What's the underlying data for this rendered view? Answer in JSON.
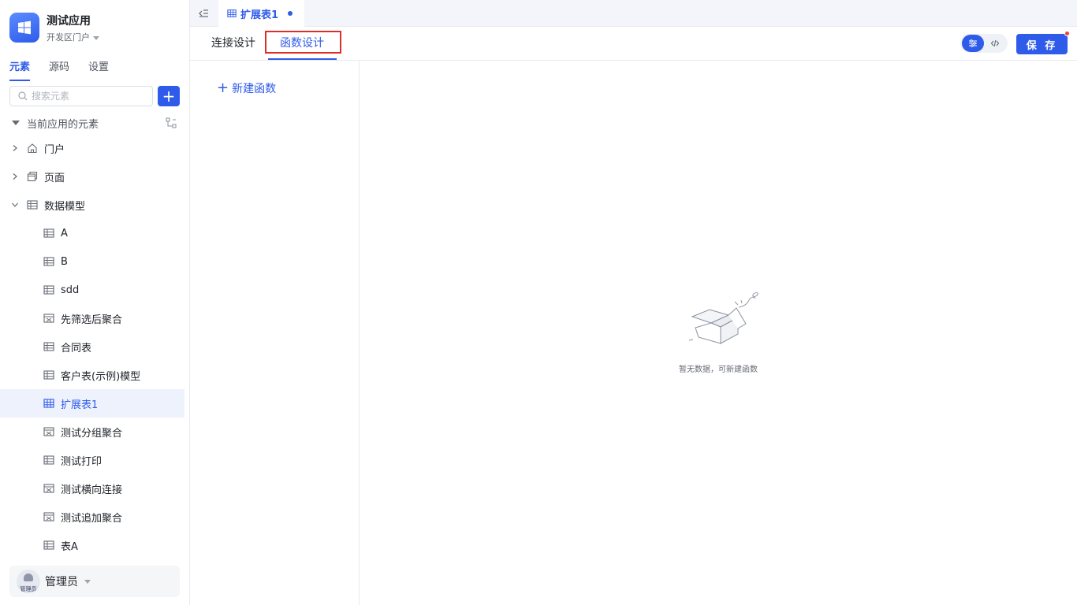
{
  "sidebar": {
    "app_name": "测试应用",
    "portal": "开发区门户",
    "tabs": [
      {
        "label": "元素",
        "active": true
      },
      {
        "label": "源码",
        "active": false
      },
      {
        "label": "设置",
        "active": false
      }
    ],
    "search": {
      "placeholder": "搜索元素",
      "value": ""
    },
    "add_label": "+",
    "section_label": "当前应用的元素",
    "tree": {
      "portal_label": "门户",
      "page_label": "页面",
      "model_label": "数据模型",
      "models": [
        "A",
        "B",
        "sdd",
        "先筛选后聚合",
        "合同表",
        "客户表(示例)模型",
        "扩展表1",
        "测试分组聚合",
        "测试打印",
        "测试横向连接",
        "测试追加聚合",
        "表A"
      ],
      "selected": "扩展表1"
    },
    "user": {
      "name": "管理员",
      "avatar_tag": "管理员"
    }
  },
  "topbar": {
    "tab_label": "扩展表1"
  },
  "design_tabs": [
    {
      "label": "连接设计",
      "active": false
    },
    {
      "label": "函数设计",
      "active": true
    }
  ],
  "toolbar": {
    "save_label": "保 存"
  },
  "content": {
    "new_function_label": "新建函数",
    "empty_text": "暂无数据，可新建函数"
  },
  "colors": {
    "accent": "#2f5bea",
    "highlight": "#d9302c",
    "selected_bg": "#eef2fd"
  }
}
